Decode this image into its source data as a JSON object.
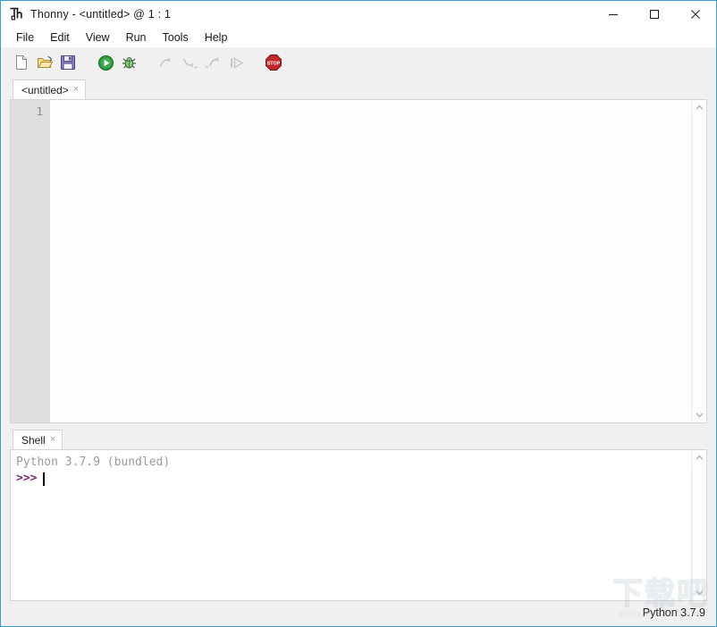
{
  "window": {
    "title": "Thonny  -  <untitled>  @  1 : 1",
    "app_icon": "thonny-logo-icon",
    "controls": {
      "minimize": "minimize-icon",
      "maximize": "maximize-icon",
      "close": "close-icon"
    }
  },
  "menubar": {
    "items": [
      {
        "label": "File"
      },
      {
        "label": "Edit"
      },
      {
        "label": "View"
      },
      {
        "label": "Run"
      },
      {
        "label": "Tools"
      },
      {
        "label": "Help"
      }
    ]
  },
  "toolbar": {
    "buttons": [
      {
        "icon": "new-file-icon",
        "title": "New",
        "enabled": true
      },
      {
        "icon": "open-folder-icon",
        "title": "Load",
        "enabled": true
      },
      {
        "icon": "save-floppy-icon",
        "title": "Save",
        "enabled": true
      },
      {
        "icon": "run-play-icon",
        "title": "Run current script",
        "enabled": true
      },
      {
        "icon": "debug-bug-icon",
        "title": "Debug current script",
        "enabled": true
      },
      {
        "icon": "step-over-icon",
        "title": "Step over",
        "enabled": false
      },
      {
        "icon": "step-into-icon",
        "title": "Step into",
        "enabled": false
      },
      {
        "icon": "step-out-icon",
        "title": "Step out",
        "enabled": false
      },
      {
        "icon": "resume-icon",
        "title": "Resume",
        "enabled": false
      },
      {
        "icon": "stop-sign-icon",
        "title": "Stop/Restart backend",
        "enabled": true
      }
    ]
  },
  "editor": {
    "tab": {
      "label": "<untitled>",
      "close_glyph": "×"
    },
    "gutter": {
      "lines": [
        "1"
      ]
    },
    "content": "",
    "scrollbar": {
      "up_glyph": "⌃",
      "down_glyph": "⌄"
    }
  },
  "shell": {
    "tab": {
      "label": "Shell",
      "close_glyph": "×"
    },
    "banner": "Python 3.7.9 (bundled)",
    "prompt": ">>>",
    "input_value": "",
    "scrollbar": {
      "up_glyph": "⌃",
      "down_glyph": "⌄"
    }
  },
  "statusbar": {
    "interpreter": "Python 3.7.9"
  },
  "watermark": {
    "text": "下载吧",
    "url": "www.xiazaiba.com"
  },
  "colors": {
    "window_border": "#3a9ccc",
    "chrome_bg": "#f0f0f0",
    "editor_bg": "#fdfdfd",
    "gutter_bg": "#dededf",
    "gutter_fg": "#8a8a8a",
    "shell_banner_fg": "#9a9a9a",
    "shell_prompt_fg": "#7a2a72",
    "run_green": "#2e9a3e",
    "stop_red": "#c1272d",
    "tab_border": "#d4d4d4"
  }
}
